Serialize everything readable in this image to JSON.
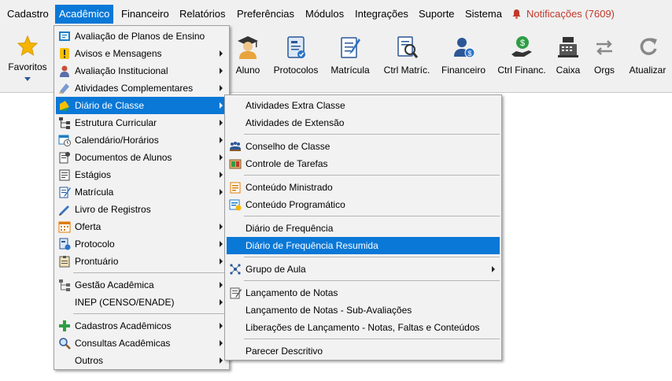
{
  "menubar": {
    "items": [
      {
        "label": "Cadastro"
      },
      {
        "label": "Acadêmico"
      },
      {
        "label": "Financeiro"
      },
      {
        "label": "Relatórios"
      },
      {
        "label": "Preferências"
      },
      {
        "label": "Módulos"
      },
      {
        "label": "Integrações"
      },
      {
        "label": "Suporte"
      },
      {
        "label": "Sistema"
      }
    ],
    "notifications": "Notificações (7609)"
  },
  "toolbar": {
    "favorites": "Favoritos",
    "buttons": [
      {
        "label": "Aluno",
        "icon": "student-icon"
      },
      {
        "label": "Protocolos",
        "icon": "protocol-icon"
      },
      {
        "label": "Matrícula",
        "icon": "enrollment-icon"
      },
      {
        "label": "Ctrl Matríc.",
        "icon": "enrollment-control-icon"
      },
      {
        "label": "Financeiro",
        "icon": "financial-icon"
      },
      {
        "label": "Ctrl Financ.",
        "icon": "financial-control-icon"
      },
      {
        "label": "Caixa",
        "icon": "cash-register-icon"
      },
      {
        "label": "Orgs",
        "icon": "swap-icon"
      },
      {
        "label": "Atualizar",
        "icon": "refresh-icon"
      }
    ]
  },
  "academic_menu": {
    "items": [
      {
        "label": "Avaliação de Planos de Ensino",
        "icon": "teaching-plan-icon"
      },
      {
        "label": "Avisos e Mensagens",
        "icon": "notice-icon"
      },
      {
        "label": "Avaliação Institucional",
        "icon": "institutional-evaluation-icon"
      },
      {
        "label": "Atividades Complementares",
        "icon": "complementary-activities-icon"
      },
      {
        "label": "Diário de Classe",
        "icon": "class-diary-icon"
      },
      {
        "label": "Estrutura Curricular",
        "icon": "curriculum-structure-icon"
      },
      {
        "label": "Calendário/Horários",
        "icon": "calendar-icon"
      },
      {
        "label": "Documentos de Alunos",
        "icon": "student-documents-icon"
      },
      {
        "label": "Estágios",
        "icon": "internship-icon"
      },
      {
        "label": "Matrícula",
        "icon": "enrollment-icon"
      },
      {
        "label": "Livro de Registros",
        "icon": "record-book-icon"
      },
      {
        "label": "Oferta",
        "icon": "offer-icon"
      },
      {
        "label": "Protocolo",
        "icon": "protocol-icon"
      },
      {
        "label": "Prontuário",
        "icon": "student-record-icon"
      },
      {
        "label": "Gestão Acadêmica",
        "icon": "academic-management-icon"
      },
      {
        "label": "INEP (CENSO/ENADE)",
        "icon": ""
      },
      {
        "label": "Cadastros Acadêmicos",
        "icon": "plus-icon"
      },
      {
        "label": "Consultas Acadêmicas",
        "icon": "magnifier-icon"
      },
      {
        "label": "Outros",
        "icon": ""
      }
    ]
  },
  "class_diary_menu": {
    "items": [
      {
        "label": "Atividades Extra Classe"
      },
      {
        "label": "Atividades de Extensão"
      },
      {
        "label": "Conselho de Classe"
      },
      {
        "label": "Controle de Tarefas"
      },
      {
        "label": "Conteúdo Ministrado"
      },
      {
        "label": "Conteúdo Programático"
      },
      {
        "label": "Diário de Frequência"
      },
      {
        "label": "Diário de Frequência Resumida"
      },
      {
        "label": "Grupo de Aula"
      },
      {
        "label": "Lançamento de Notas"
      },
      {
        "label": "Lançamento de Notas - Sub-Avaliações"
      },
      {
        "label": "Liberações de Lançamento - Notas, Faltas e Conteúdos"
      },
      {
        "label": "Parecer Descritivo"
      }
    ]
  },
  "colors": {
    "highlight": "#0a78d7",
    "notification": "#c0392b"
  }
}
